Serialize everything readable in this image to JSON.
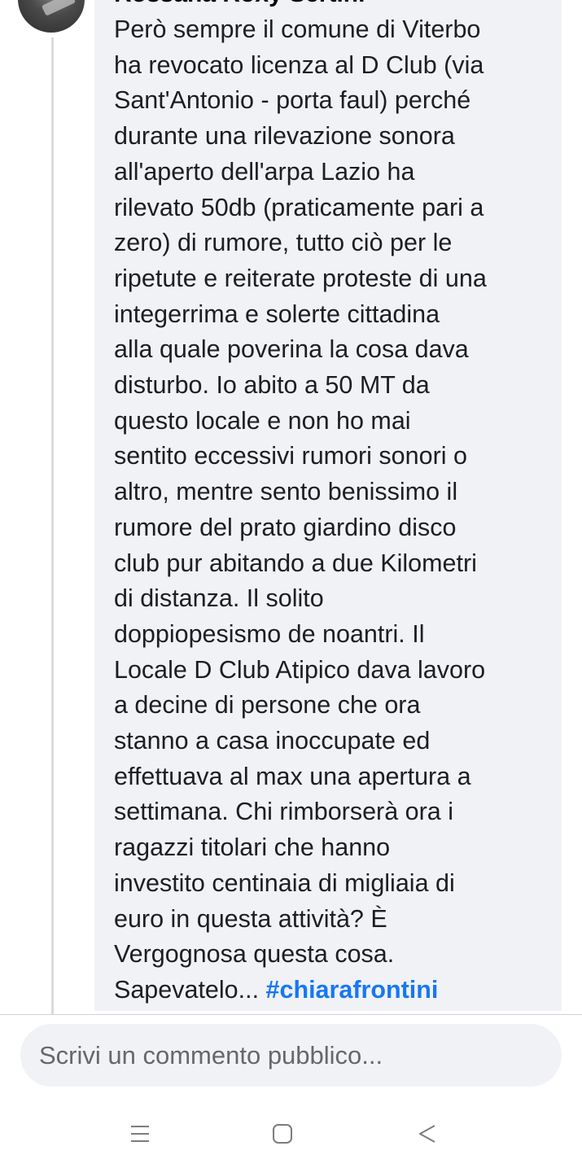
{
  "comment": {
    "author_name": "Rossana Roxy Sertini",
    "lines": [
      "Però sempre il comune di Viterbo",
      "ha revocato licenza al D Club (via",
      "Sant'Antonio - porta faul) perché",
      "durante una rilevazione sonora",
      "all'aperto dell'arpa Lazio ha",
      "rilevato 50db (praticamente pari a",
      "zero) di rumore, tutto ciò per le",
      "ripetute e reiterate proteste di una",
      "integerrima e solerte cittadina",
      "alla quale poverina la cosa dava",
      "disturbo. Io abito a 50 MT da",
      "questo locale e non ho mai",
      "sentito eccessivi rumori sonori o",
      "altro, mentre sento benissimo il",
      "rumore del prato giardino disco",
      "club  pur abitando a due Kilometri",
      "di distanza. Il solito",
      "doppiopesismo de noantri. Il",
      "Locale D Club Atipico dava lavoro",
      "a decine di persone che ora",
      "stanno a casa inoccupate ed",
      "effettuava al max una apertura a",
      "settimana. Chi rimborserà ora i",
      "ragazzi titolari che hanno",
      "investito centinaia di migliaia di",
      "euro in questa attività?  È",
      "Vergognosa questa cosa."
    ],
    "last_line_text": "Sapevatelo... ",
    "hashtag": "#chiarafrontini"
  },
  "composer": {
    "placeholder": "Scrivi un commento pubblico..."
  },
  "navbar": {
    "recents_icon": "recents-icon",
    "home_icon": "home-icon",
    "back_icon": "back-icon"
  }
}
